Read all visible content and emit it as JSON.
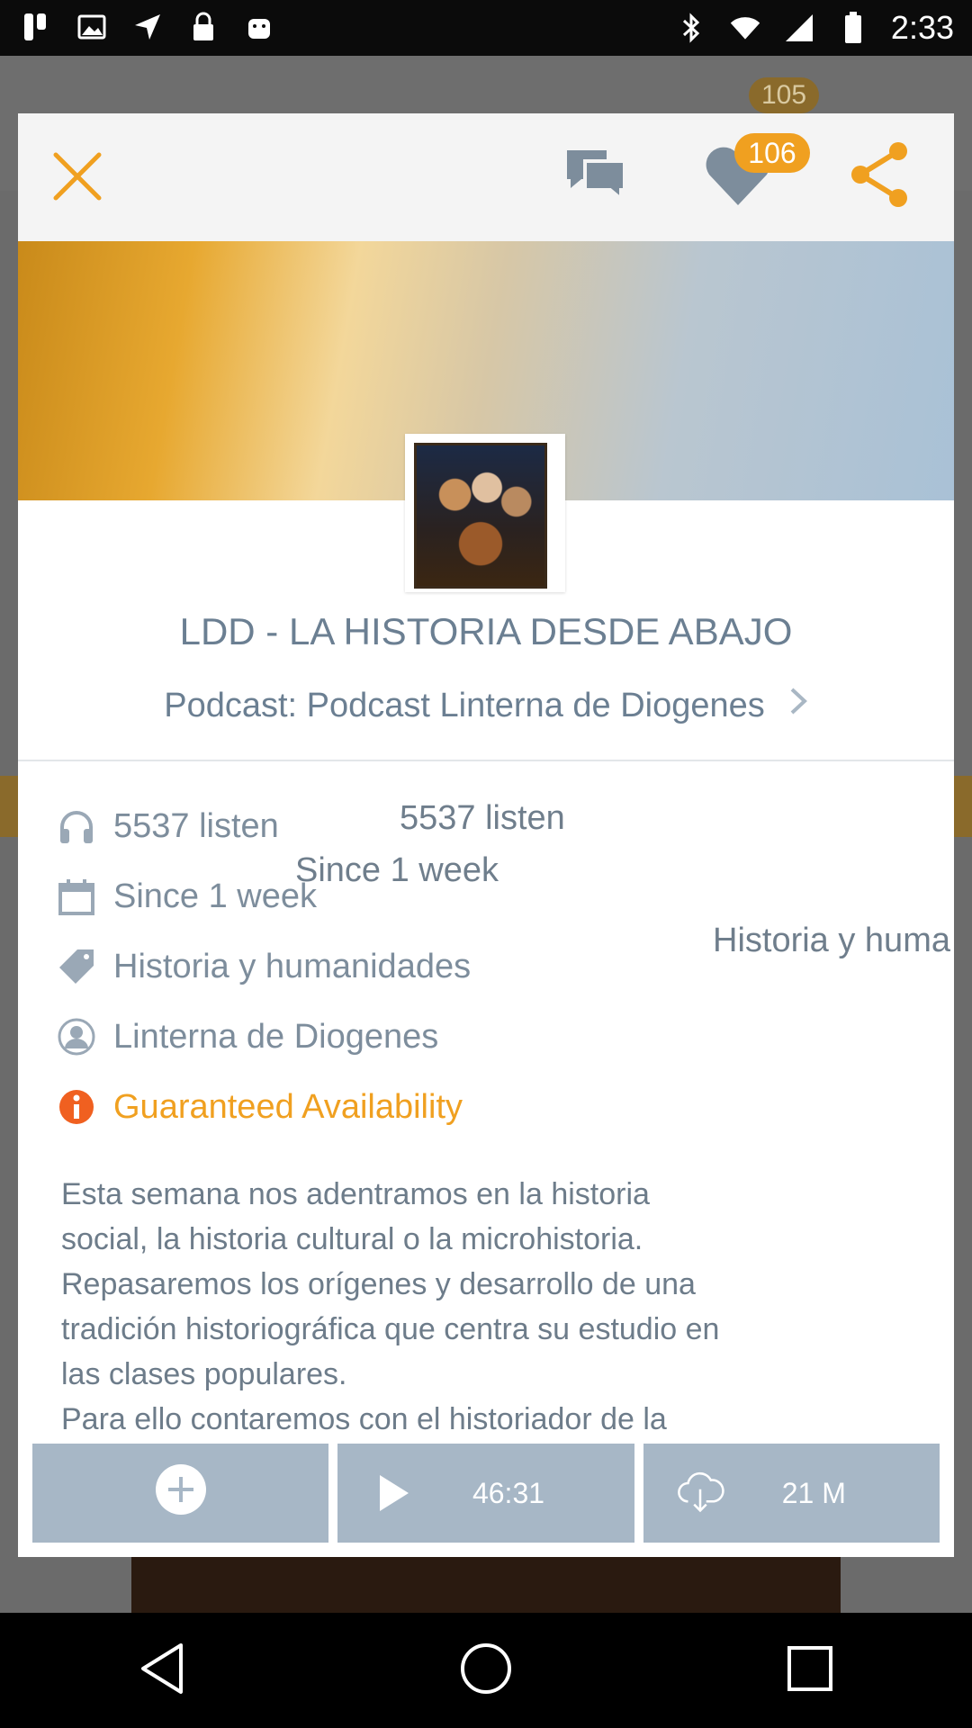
{
  "status_bar": {
    "time": "2:33",
    "icons_left": [
      "app-notification-icon",
      "image-notification-icon",
      "fake-gps-icon",
      "lock-icon",
      "android-icon"
    ],
    "icons_right": [
      "bluetooth-icon",
      "wifi-icon",
      "signal-icon",
      "battery-icon"
    ]
  },
  "background_app": {
    "badge": "105"
  },
  "header": {
    "likes_badge": "106",
    "icons": [
      "close-icon",
      "chat-icon",
      "heart-icon",
      "share-icon"
    ],
    "accent_color": "#f0a020"
  },
  "episode": {
    "title": "LDD - LA HISTORIA DESDE ABAJO",
    "podcast_label": "Podcast: Podcast Linterna de Diogenes"
  },
  "info": {
    "listens": "5537 listen",
    "since": "Since 1 week",
    "category": "Historia y humanidades",
    "author": "Linterna de Diogenes",
    "availability": "Guaranteed Availability"
  },
  "overlay_ghost": {
    "listens": "5537 listen",
    "since": "Since 1 week",
    "category": "Historia y huma"
  },
  "description": [
    "Esta semana nos adentramos en la historia",
    "social, la historia cultural o la microhistoria.",
    "Repasaremos los orígenes y desarrollo de una",
    "tradición historiográfica  que centra su estudio en",
    "las clases populares.",
    "Para ello contaremos con el historiador de la"
  ],
  "actions": {
    "duration": "46:31",
    "size": "21 M"
  }
}
